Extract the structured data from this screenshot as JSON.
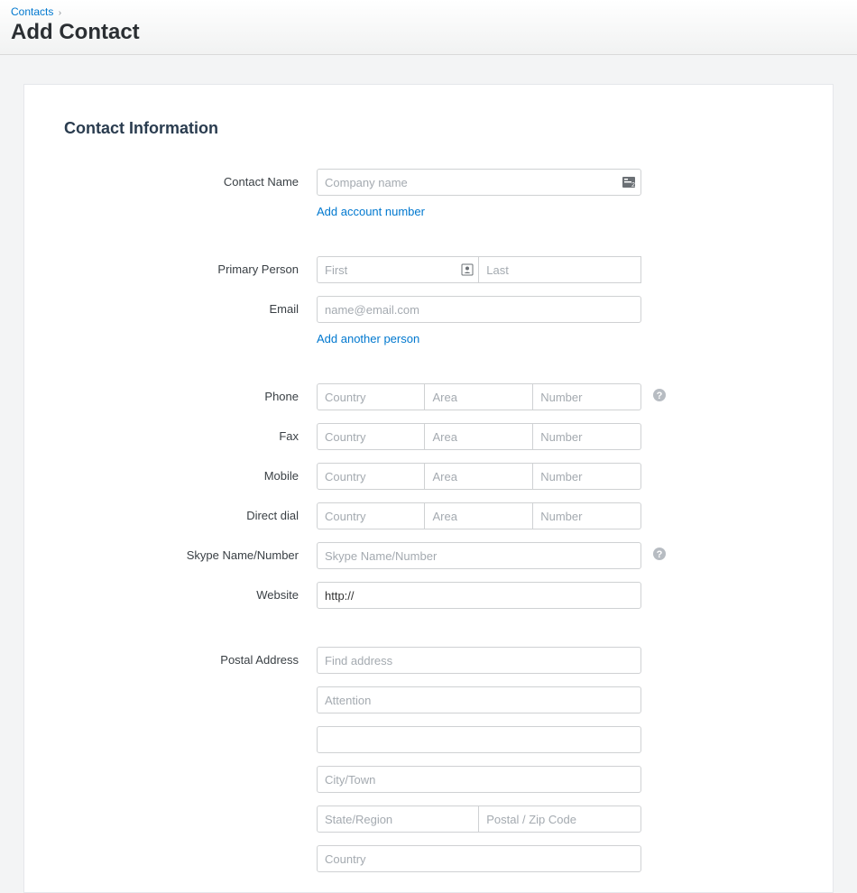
{
  "breadcrumb": {
    "root": "Contacts",
    "sep": "›"
  },
  "page_title": "Add Contact",
  "section_title": "Contact Information",
  "contact_name": {
    "label": "Contact Name",
    "placeholder": "Company name",
    "add_account_link": "Add account number"
  },
  "primary_person": {
    "label": "Primary Person",
    "first_placeholder": "First",
    "last_placeholder": "Last"
  },
  "email": {
    "label": "Email",
    "placeholder": "name@email.com",
    "add_person_link": "Add another person"
  },
  "phone": {
    "label": "Phone",
    "country_placeholder": "Country",
    "area_placeholder": "Area",
    "number_placeholder": "Number"
  },
  "fax": {
    "label": "Fax",
    "country_placeholder": "Country",
    "area_placeholder": "Area",
    "number_placeholder": "Number"
  },
  "mobile": {
    "label": "Mobile",
    "country_placeholder": "Country",
    "area_placeholder": "Area",
    "number_placeholder": "Number"
  },
  "direct_dial": {
    "label": "Direct dial",
    "country_placeholder": "Country",
    "area_placeholder": "Area",
    "number_placeholder": "Number"
  },
  "skype": {
    "label": "Skype Name/Number",
    "placeholder": "Skype Name/Number"
  },
  "website": {
    "label": "Website",
    "value": "http://"
  },
  "postal": {
    "label": "Postal Address",
    "find_placeholder": "Find address",
    "attention_placeholder": "Attention",
    "city_placeholder": "City/Town",
    "state_placeholder": "State/Region",
    "zip_placeholder": "Postal / Zip Code",
    "country_placeholder": "Country"
  }
}
